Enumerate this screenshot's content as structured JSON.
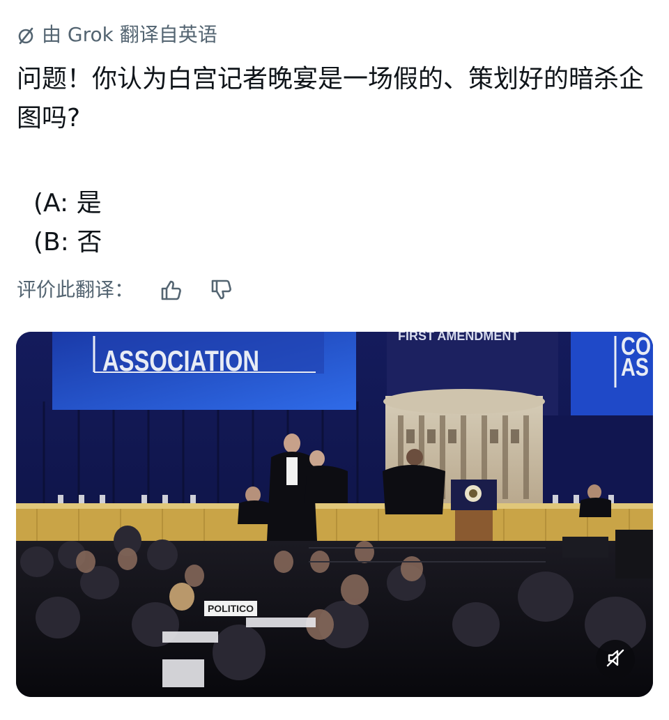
{
  "translation_header": {
    "icon": "slash-circle-icon",
    "text": "由 Grok 翻译自英语"
  },
  "post": {
    "text": "问题！你认为白宫记者晚宴是一场假的、策划好的暗杀企图吗?",
    "options": [
      "(A: 是",
      "(B: 否"
    ]
  },
  "rating": {
    "label": "评价此翻译：",
    "thumbs_up_icon": "thumbs-up-icon",
    "thumbs_down_icon": "thumbs-down-icon"
  },
  "media": {
    "banner_left": "ASSOCIATION",
    "banner_mid": "FIRST AMENDMENT",
    "banner_right_1": "CO",
    "banner_right_2": "AS",
    "sign": "POLITICO",
    "mute_icon": "muted-speaker-icon"
  },
  "colors": {
    "text": "#0f1419",
    "secondary": "#536471"
  }
}
